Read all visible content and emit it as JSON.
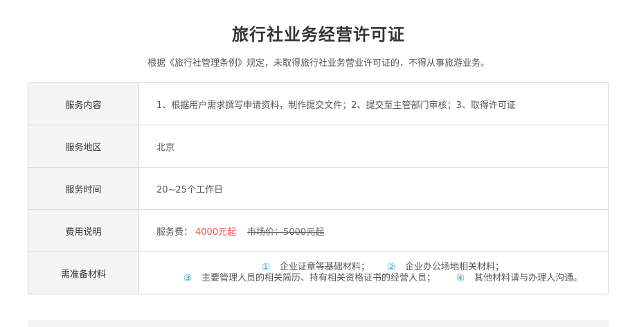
{
  "page": {
    "title": "旅行社业务经营许可证",
    "subtitle": "根据《旅行社管理条例》规定，未取得旅行社业务营业许可证的，不得从事旅游业务。"
  },
  "table": {
    "service_content": {
      "label": "服务内容",
      "value": "1、根据用户需求撰写申请资料，制作提交文件；2、提交至主管部门审核；3、取得许可证"
    },
    "service_area": {
      "label": "服务地区",
      "value": "北京"
    },
    "service_time": {
      "label": "服务时间",
      "value": "20~25个工作日"
    },
    "fee": {
      "label": "费用说明",
      "service_fee_label": "服务费：",
      "service_fee": "4000元起",
      "market_price": "市场价：5000元起"
    },
    "materials": {
      "label": "需准备材料",
      "items": [
        {
          "num": "①",
          "text": "企业证章等基础材料；"
        },
        {
          "num": "②",
          "text": "企业办公场地相关材料；"
        },
        {
          "num": "③",
          "text": "主要管理人员的相关简历、持有相关资格证书的经营人员；"
        },
        {
          "num": "④",
          "text": "其他材料请与办理人沟通。"
        }
      ]
    }
  },
  "colors": {
    "price": "#e65050",
    "number_accent": "#2f9ec8",
    "label_bg": "#f5f5f5",
    "border": "#d9d9d9"
  }
}
